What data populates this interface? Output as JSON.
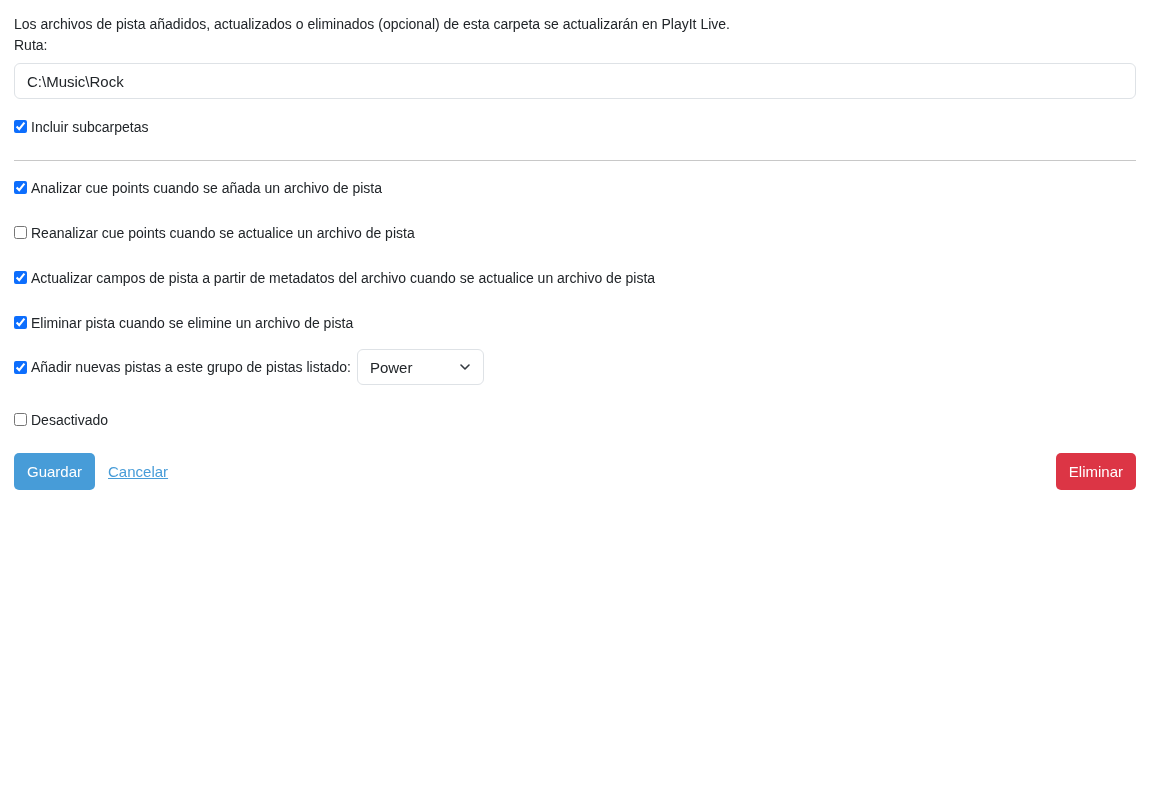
{
  "description": "Los archivos de pista añadidos, actualizados o eliminados (opcional) de esta carpeta se actualizarán en PlayIt Live.",
  "path_field": {
    "label": "Ruta:",
    "value": "C:\\Music\\Rock"
  },
  "include_subfolders": {
    "label": "Incluir subcarpetas",
    "checked": true
  },
  "options": [
    {
      "kind": "checkbox",
      "label": "Analizar cue points cuando se añada un archivo de pista",
      "checked": true
    },
    {
      "kind": "checkbox",
      "label": "Reanalizar cue points cuando se actualice un archivo de pista",
      "checked": false
    },
    {
      "kind": "checkbox",
      "label": "Actualizar campos de pista a partir de metadatos del archivo cuando se actualice un archivo de pista",
      "checked": true
    },
    {
      "kind": "checkbox",
      "label": "Eliminar pista cuando se elimine un archivo de pista",
      "checked": true
    },
    {
      "kind": "checkbox-select",
      "label": "Añadir nuevas pistas a este grupo de pistas listado:",
      "checked": true,
      "select_value": "Power"
    },
    {
      "kind": "checkbox",
      "label": "Desactivado",
      "checked": false
    }
  ],
  "buttons": {
    "save": "Guardar",
    "cancel": "Cancelar",
    "delete": "Eliminar"
  }
}
